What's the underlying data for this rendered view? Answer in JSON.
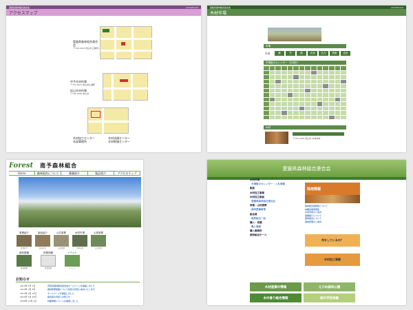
{
  "panel1": {
    "header_left": "愛媛県森林組合連合会",
    "header_right": "ehimeforest",
    "title": "アクセスマップ",
    "offices": [
      {
        "name": "愛媛県森林組合連合会",
        "addr": "〒790-0003 松山市三番町4丁目"
      },
      {
        "name": "中予木材市場",
        "addr": "〒791-8013 松山市山越町"
      },
      {
        "name": "松山木材市場",
        "addr": "〒791-0000 松山市"
      }
    ],
    "bottom_notes": [
      "木材加工センター",
      "本部事務所",
      "木材流通センター",
      "木材乾燥センター"
    ]
  },
  "panel2": {
    "header_left": "愛媛県森林組合連合会",
    "header_right": "ehimeforest",
    "title": "木材市場",
    "section1": "市場",
    "filter_label": "市場",
    "filters": [
      "東",
      "予",
      "南",
      "大洲",
      "久万",
      "西条",
      "合計"
    ],
    "section2": "市場取引カレンダー（平成年）",
    "section3": "木材",
    "bottom_text": "〒791-0000 松山市 木材市場"
  },
  "panel3": {
    "logo": "Forest",
    "union_name": "南予森林組合",
    "nav": [
      "Home",
      "森林組合について",
      "事業紹介",
      "製品紹介",
      "アクセスマップ"
    ],
    "thumbs_row1": [
      "事業紹介",
      "製品紹介",
      "公共事業",
      "木材市場",
      "公営事業"
    ],
    "thumbs_row2": [
      "森林整備",
      "林業体験",
      "イベント"
    ],
    "news_title": "お知らせ",
    "news": [
      {
        "date": "2010年 4月 1日",
        "text": "高知県森林組合連合会ホームページを開設しました"
      },
      {
        "date": "2010年 3月 8日",
        "text": "森林整備事業について県民の皆様に案内いたします"
      },
      {
        "date": "2010年 2月 15日",
        "text": "ホームページを開設しました"
      },
      {
        "date": "2010年 1月 20日",
        "text": "組合員の皆様へお知らせ"
      },
      {
        "date": "2009年 12月 1日",
        "text": "林業体験イベントを開催しました"
      }
    ]
  },
  "panel4": {
    "banner": "愛媛県森林組合連合会",
    "left_items": [
      {
        "t": "木材市場",
        "k": "hd"
      },
      {
        "t": "市場取引カレンダー・入札情報",
        "k": "lk"
      },
      {
        "t": "製品",
        "k": "hd"
      },
      {
        "t": "木材加工事業",
        "k": "hd"
      },
      {
        "t": "木材加工製品",
        "k": "hd"
      },
      {
        "t": "愛媛県森林組合連合会",
        "k": "lk"
      },
      {
        "t": "林業・山村振興",
        "k": "hd"
      },
      {
        "t": "森林整備事業",
        "k": "lk"
      },
      {
        "t": "組合員",
        "k": "hd"
      },
      {
        "t": "森林組合一覧",
        "k": "lk"
      },
      {
        "t": "購入・見積",
        "k": "hd"
      },
      {
        "t": "購入情報",
        "k": "lk"
      },
      {
        "t": "購入事務所",
        "k": "hd"
      },
      {
        "t": "森林組合ホール",
        "k": "hd"
      }
    ],
    "recruit": "採用情報",
    "side_links": [
      "森林組合員募集について",
      "林業従事者募集",
      "木材市場のご案内",
      "事業紹介について",
      "森林組合について",
      "森林整備のご案内"
    ],
    "orange_box": "何をしているの？",
    "orange_box2": "木材加工事業",
    "bottom_banners": [
      "木材産業の情報",
      "えひめ森林公園",
      "木の香り総合情報",
      "森の学校体験"
    ]
  }
}
